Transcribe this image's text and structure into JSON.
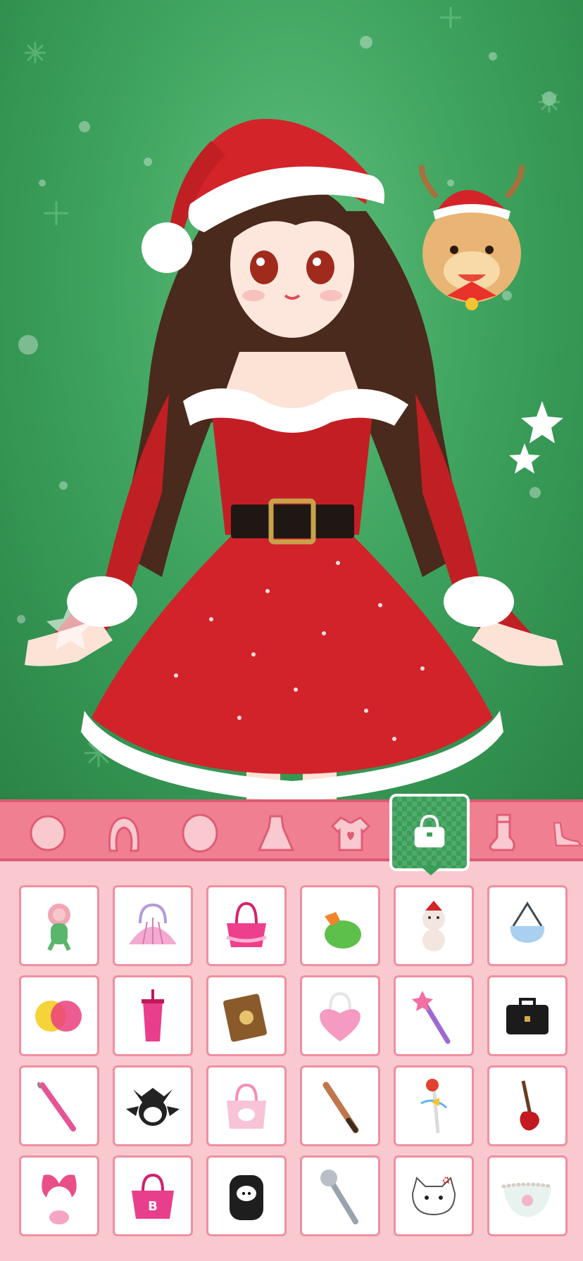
{
  "game": {
    "scene": "christmas-dress-up",
    "background_color": "#3fa45f",
    "character": {
      "hat": "santa-hat",
      "outfit": "red-santa-dress-with-fur-trim",
      "belt": "black-belt-gold-buckle",
      "hair_color": "#4a2a1c"
    },
    "companion": "reindeer-plush-with-santa-hat"
  },
  "category_tabs": [
    {
      "name": "face-tab",
      "icon": "face-icon",
      "active": false
    },
    {
      "name": "hair-tab",
      "icon": "hair-icon",
      "active": false
    },
    {
      "name": "head-tab",
      "icon": "head-icon",
      "active": false
    },
    {
      "name": "dress-tab",
      "icon": "dress-icon",
      "active": false
    },
    {
      "name": "top-tab",
      "icon": "shirt-icon",
      "active": false
    },
    {
      "name": "bag-tab",
      "icon": "bag-icon",
      "active": true
    },
    {
      "name": "socks-tab",
      "icon": "sock-icon",
      "active": false
    },
    {
      "name": "shoes-tab",
      "icon": "shoe-icon",
      "active": false
    }
  ],
  "items": [
    "dinosaur-plush-icon",
    "seashell-purse-icon",
    "pink-frill-handbag-icon",
    "coconut-drink-icon",
    "teddy-bear-santa-icon",
    "blue-shoulder-bag-icon",
    "pompoms-icon",
    "pink-tumbler-icon",
    "spell-book-icon",
    "pink-heart-purse-icon",
    "magic-wand-icon",
    "black-briefcase-icon",
    "pink-umbrella-icon",
    "kuromi-bag-icon",
    "hello-kitty-bag-icon",
    "baseball-bat-icon",
    "spoon-charm-icon",
    "electric-guitar-icon",
    "my-melody-plush-icon",
    "pink-barbie-bag-icon",
    "kuromi-backpack-icon",
    "microphone-icon",
    "hello-kitty-purse-icon",
    "pearl-clutch-icon"
  ],
  "colors": {
    "tab_bar": "#f07f92",
    "active_tab": "#3a9e58",
    "panel": "#f9c9cf",
    "cell_border": "#ef8fa0"
  }
}
